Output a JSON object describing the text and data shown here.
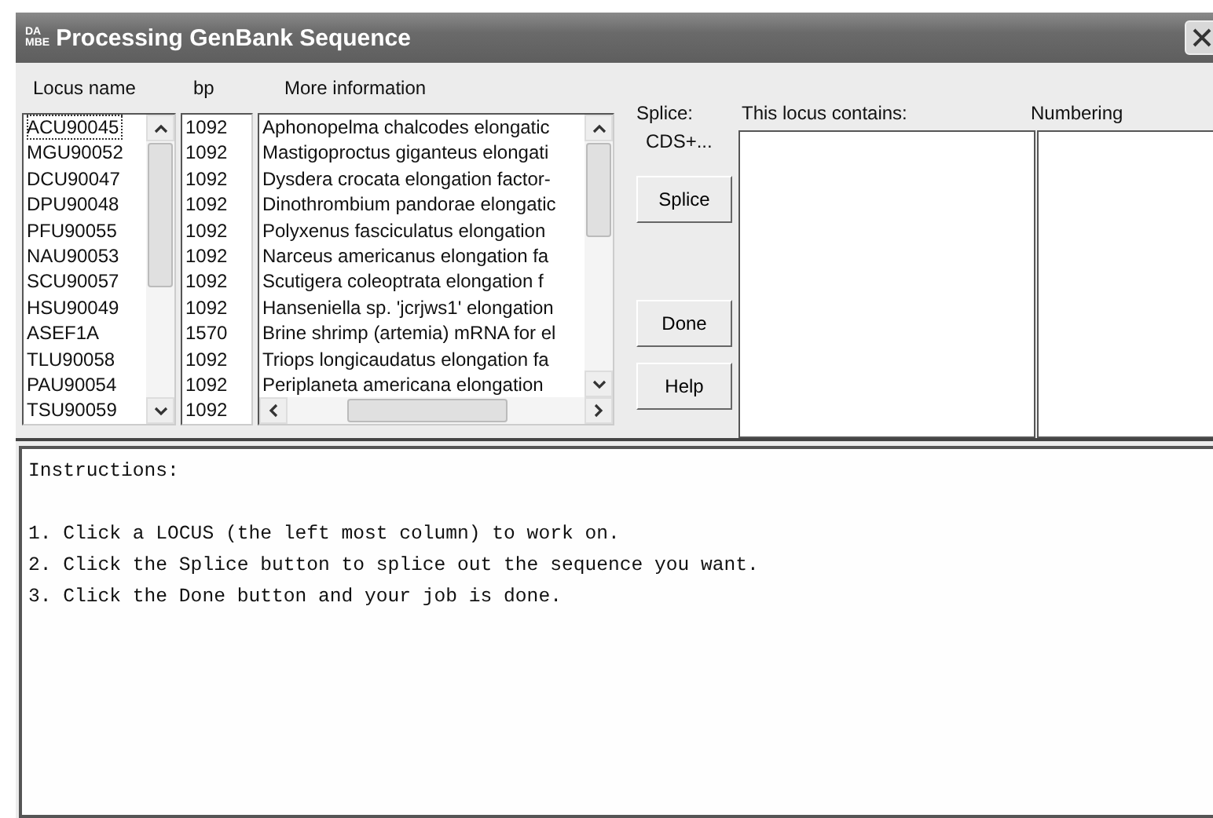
{
  "window": {
    "title": "Processing GenBank Sequence",
    "icon_top": "DA",
    "icon_bottom": "MBE"
  },
  "headers": {
    "locus": "Locus name",
    "bp": "bp",
    "info": "More information",
    "splice": "Splice:",
    "contains": "This locus contains:",
    "numbering": "Numbering"
  },
  "loci": [
    {
      "name": "ACU90045",
      "focused": true
    },
    {
      "name": "MGU90052",
      "focused": false
    },
    {
      "name": "DCU90047",
      "focused": false
    },
    {
      "name": "DPU90048",
      "focused": false
    },
    {
      "name": "PFU90055",
      "focused": false
    },
    {
      "name": "NAU90053",
      "focused": false
    },
    {
      "name": "SCU90057",
      "focused": false
    },
    {
      "name": "HSU90049",
      "focused": false
    },
    {
      "name": "ASEF1A",
      "focused": false
    },
    {
      "name": "TLU90058",
      "focused": false
    },
    {
      "name": "PAU90054",
      "focused": false
    },
    {
      "name": "TSU90059",
      "focused": false
    }
  ],
  "bp": [
    "1092",
    "1092",
    "1092",
    "1092",
    "1092",
    "1092",
    "1092",
    "1092",
    "1570",
    "1092",
    "1092",
    "1092"
  ],
  "info": [
    "Aphonopelma chalcodes elongatic",
    "Mastigoproctus giganteus elongati",
    "Dysdera crocata elongation factor-",
    "Dinothrombium pandorae elongatic",
    "Polyxenus fasciculatus elongation",
    "Narceus americanus elongation fa",
    "Scutigera coleoptrata elongation f",
    "Hanseniella sp. 'jcrjws1' elongation",
    "Brine shrimp (artemia) mRNA for el",
    "Triops longicaudatus elongation fa",
    "Periplaneta americana elongation"
  ],
  "splice_value": "CDS+...",
  "buttons": [
    "Splice",
    "Done",
    "Help"
  ],
  "instructions": {
    "heading": "Instructions:",
    "steps": [
      "1. Click a LOCUS (the left most column) to work on.",
      "2. Click the Splice button to splice out the sequence you want.",
      "3. Click the Done button and your job is done."
    ]
  }
}
